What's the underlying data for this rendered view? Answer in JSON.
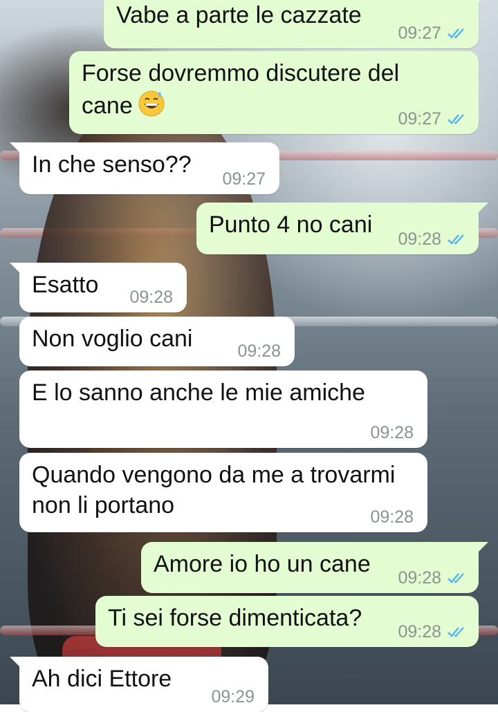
{
  "chat": {
    "messages": [
      {
        "direction": "out",
        "text": "Vabe a parte le cazzate",
        "time": "09:27",
        "status": "read",
        "tail": true
      },
      {
        "direction": "out",
        "text": "Forse dovremmo discutere del\ncane",
        "emoji": "grinning-face-with-sweat",
        "time": "09:27",
        "status": "read",
        "tail": false
      },
      {
        "direction": "in",
        "text": "In che senso??",
        "time": "09:27",
        "tail": true
      },
      {
        "direction": "out",
        "text": "Punto 4 no cani",
        "time": "09:28",
        "status": "read",
        "tail": true
      },
      {
        "direction": "in",
        "text": "Esatto",
        "time": "09:28",
        "tail": true
      },
      {
        "direction": "in",
        "text": "Non voglio cani",
        "time": "09:28",
        "tail": false
      },
      {
        "direction": "in",
        "text": "E lo sanno anche le mie amiche",
        "time": "09:28",
        "tail": false
      },
      {
        "direction": "in",
        "text": "Quando vengono da me a trovarmi\nnon li portano",
        "time": "09:28",
        "tail": false
      },
      {
        "direction": "out",
        "text": "Amore io ho un cane",
        "time": "09:28",
        "status": "read",
        "tail": true
      },
      {
        "direction": "out",
        "text": "Ti sei forse dimenticata?",
        "time": "09:28",
        "status": "read",
        "tail": false
      },
      {
        "direction": "in",
        "text": "Ah dici Ettore",
        "time": "09:29",
        "tail": true
      }
    ]
  },
  "colors": {
    "outgoing_bubble": "#e3fcd2",
    "incoming_bubble": "#ffffff",
    "read_ticks": "#4fb6ec",
    "timestamp": "#8a948f"
  }
}
